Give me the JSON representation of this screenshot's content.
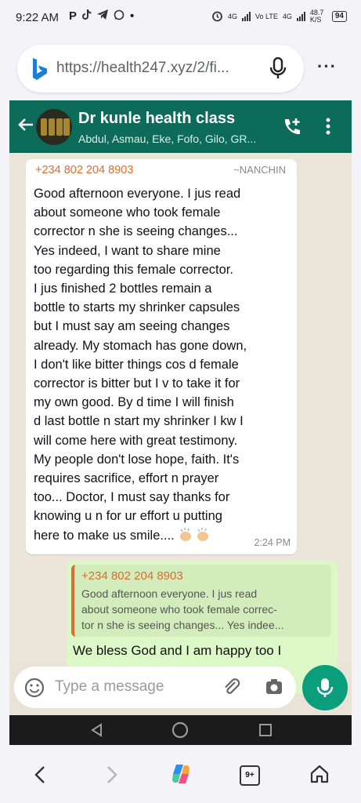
{
  "status_bar": {
    "time": "9:22 AM",
    "app_icons": [
      "P",
      "tiktok-icon",
      "telegram-icon",
      "whatsapp-icon",
      "•"
    ],
    "network_1": "4G",
    "volte": "Vo LTE",
    "network_2": "4G",
    "speed": "48.7 K/S",
    "battery": "94"
  },
  "browser": {
    "url": "https://health247.xyz/2/fi...",
    "tab_count": "9+"
  },
  "chat": {
    "group_name": "Dr kunle health class",
    "members": "Abdul, Asmau, Eke, Fofo, Gilo, GR...",
    "incoming": {
      "sender_phone": "+234 802 204 8903",
      "sender_name": "~NANCHIN",
      "text": "Good afternoon everyone. I jus read\nabout someone who took female\ncorrector n she is seeing changes...\nYes indeed, I want to  share mine\ntoo regarding this female corrector.\nI jus finished 2 bottles remain a\nbottle to starts my shrinker capsules\nbut I must say am seeing changes\nalready. My stomach has gone down,\nI don't like bitter things cos d female\ncorrector is bitter but I v to take it for\nmy own good. By d time I will finish\nd last bottle n start my shrinker I kw I\nwill come here with great testimony.\nMy people don't lose hope, faith. It's\nrequires sacrifice, effort n prayer\ntoo... Doctor, I must say thanks for\nknowing u n for ur effort u putting\nhere to make us smile....",
      "time": "2:24 PM"
    },
    "outgoing": {
      "quote_phone": "+234 802 204 8903",
      "quote_text": "Good afternoon everyone. I jus read\nabout someone who took female correc-\ntor n she is seeing changes... Yes indee...",
      "text": "We bless God and I am happy too I"
    },
    "input_placeholder": "Type a message"
  },
  "colors": {
    "header": "#0c6b59",
    "outgoing_bubble": "#dcf8c6",
    "sender": "#e26b2d",
    "fab": "#0a9e7d"
  }
}
